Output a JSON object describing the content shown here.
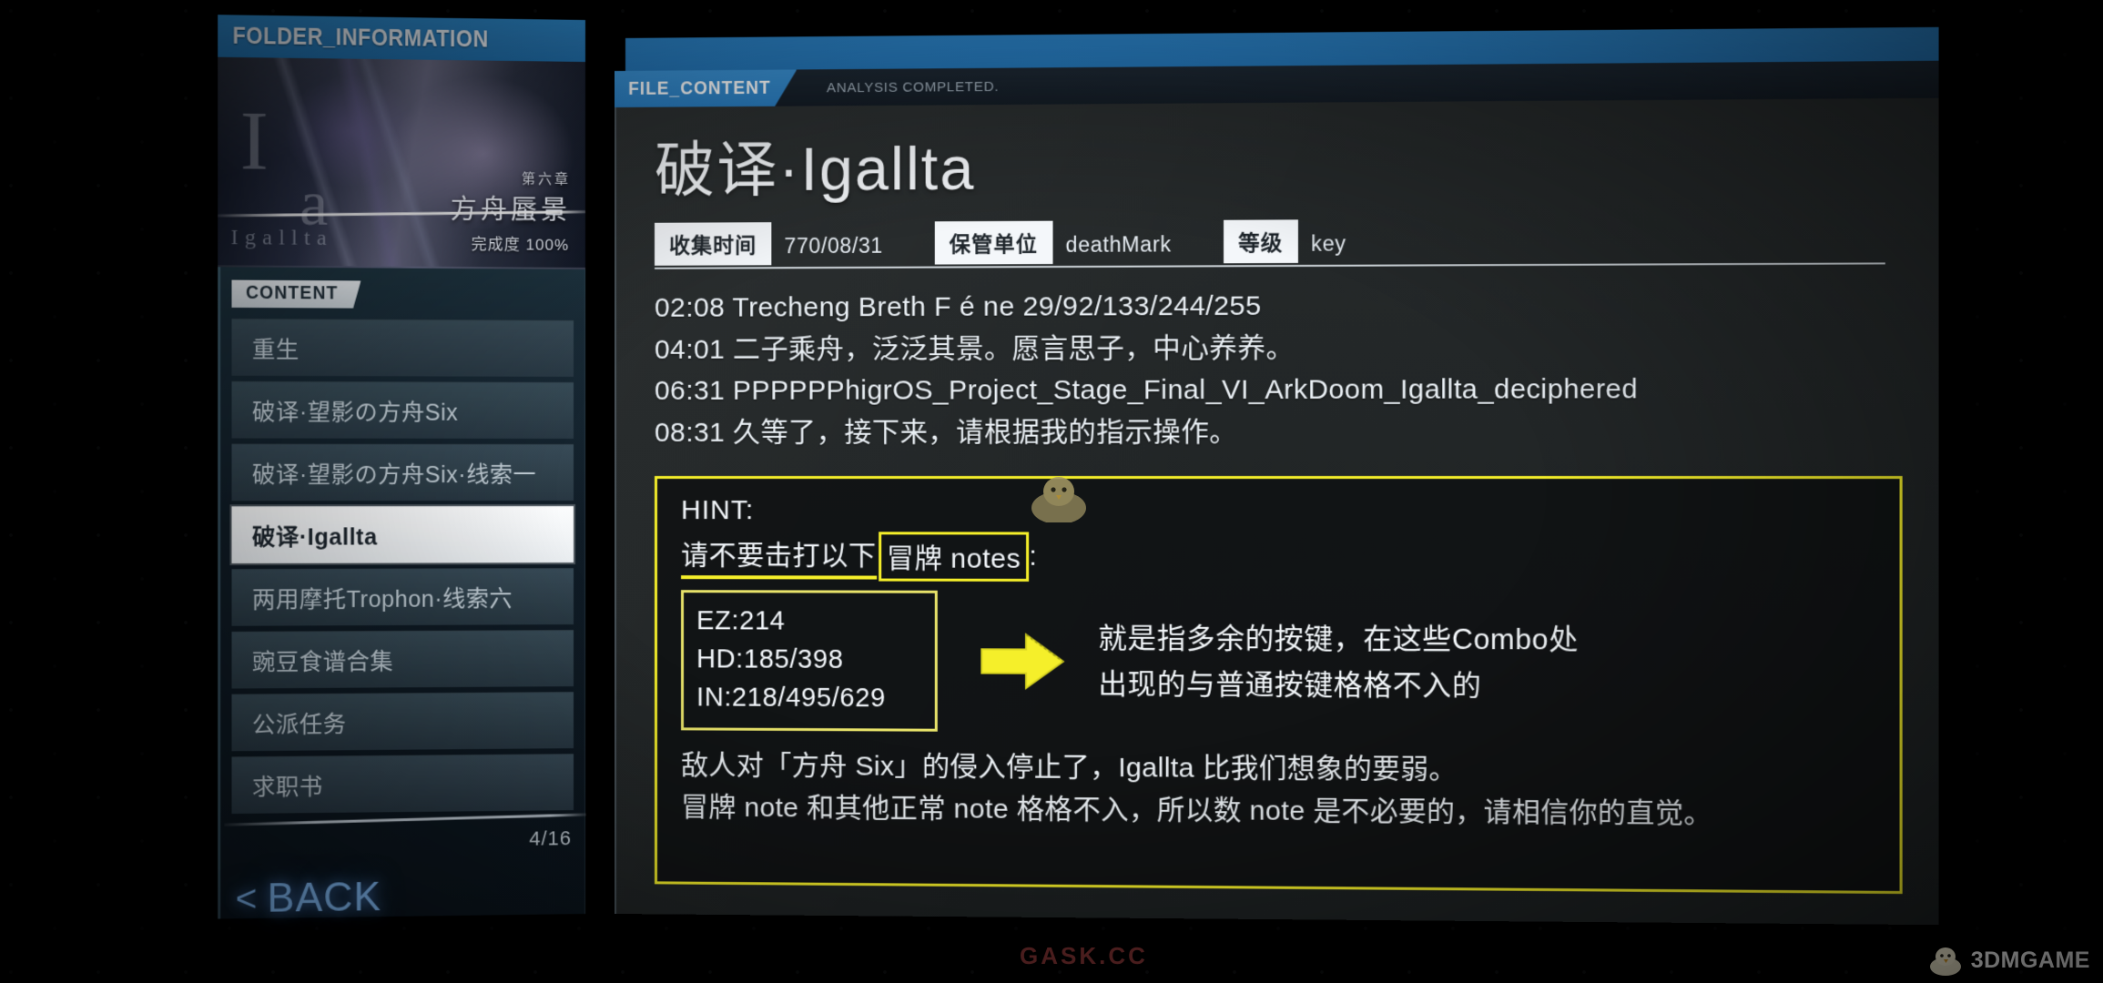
{
  "folder": {
    "header_title": "FOLDER_INFORMATION",
    "thumb_letters_top": "I",
    "thumb_letters_mid": "a",
    "thumb_name_small": "Igallta",
    "chapter_number": "第六章",
    "chapter_name": "方舟蜃景",
    "completion": "完成度 100%",
    "content_tab": "CONTENT",
    "items": [
      {
        "label": "重生",
        "selected": false
      },
      {
        "label": "破译·望影の方舟Six",
        "selected": false
      },
      {
        "label": "破译·望影の方舟Six·线索一",
        "selected": false
      },
      {
        "label": "破译·Igallta",
        "selected": true
      },
      {
        "label": "两用摩托Trophon·线索六",
        "selected": false
      },
      {
        "label": "豌豆食谱合集",
        "selected": false
      },
      {
        "label": "公派任务",
        "selected": false
      },
      {
        "label": "求职书",
        "selected": false
      }
    ],
    "counter": "4/16",
    "back_chevron": "<",
    "back_label": "BACK"
  },
  "file_panel": {
    "tag": "FILE_CONTENT",
    "status": "ANALYSIS COMPLETED.",
    "title": "破译·Igallta",
    "meta": [
      {
        "key": "收集时间",
        "value": "770/08/31"
      },
      {
        "key": "保管单位",
        "value": "deathMark"
      },
      {
        "key": "等级",
        "value": "key"
      }
    ],
    "log_lines": [
      "02:08 Trecheng Breth F é ne 29/92/133/244/255",
      "04:01 二子乘舟，泛泛其景。愿言思子，中心养养。",
      "06:31 PPPPPPhigrOS_Project_Stage_Final_VI_ArkDoom_Igallta_deciphered",
      "08:31 久等了，接下来，请根据我的指示操作。"
    ],
    "hint": {
      "title": "HINT:",
      "line2_underlined": "请不要击打以下",
      "line2_boxed": "冒牌 notes",
      "line2_tail": ":",
      "scores": [
        "EZ:214",
        "HD:185/398",
        "IN:218/495/629"
      ],
      "arrow": "arrow-right-icon",
      "side_text": [
        "就是指多余的按键，在这些Combo处",
        "出现的与普通按键格格不入的"
      ],
      "footer": [
        "敌人对「方舟 Six」的侵入停止了，Igallta 比我们想象的要弱。",
        "冒牌 note 和其他正常 note 格格不入，所以数 note 是不必要的，请相信你的直觉。"
      ]
    }
  },
  "watermarks": {
    "center": "GASK.CC",
    "corner": "3DMGAME"
  },
  "colors": {
    "accent_blue": "#2d86cb",
    "hint_yellow": "#f5ef2a",
    "panel_bg": "#232728",
    "sidebar_bg": "#0f1a22"
  }
}
